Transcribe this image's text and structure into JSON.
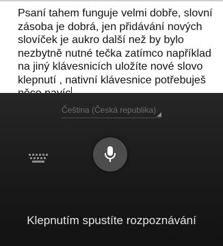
{
  "editor": {
    "text": "Psaní tahem funguje velmi dobře, slovní zásoba je dobrá, jen přidávání nových slovíček je aukro další než by bylo nezbytně nutné tečka zatímco například na jiný klávesnicích uložíte nové slovo klepnutí , nativní klávesnice potřebuješ něco navíc"
  },
  "voice_input": {
    "language": "Čeština (Česká republika)",
    "hint": "Klepnutím spustíte rozpoznávání",
    "icons": {
      "keyboard": "keyboard-icon",
      "microphone": "microphone-icon",
      "dropdown": "dropdown-triangle-icon"
    }
  }
}
